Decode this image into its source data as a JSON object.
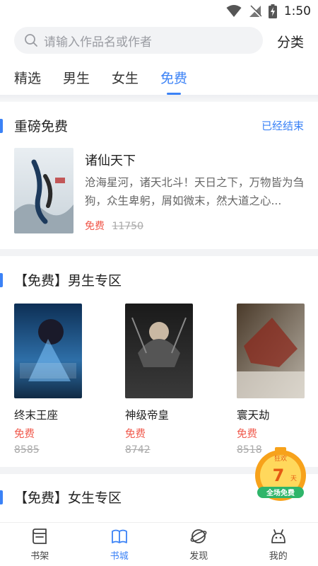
{
  "status_bar": {
    "time": "1:50"
  },
  "search": {
    "placeholder": "请输入作品名或作者",
    "category_label": "分类"
  },
  "tabs": [
    {
      "label": "精选",
      "active": false
    },
    {
      "label": "男生",
      "active": false
    },
    {
      "label": "女生",
      "active": false
    },
    {
      "label": "免费",
      "active": true
    }
  ],
  "featured_section": {
    "title": "重磅免费",
    "status_link": "已经结束",
    "book": {
      "title": "诸仙天下",
      "description": "沧海星河，诸天北斗！天日之下，万物皆为刍狗，众生卑躬，屑如微末，然大道之心...",
      "price_label": "免费",
      "original_price": "11750"
    }
  },
  "male_section": {
    "title": "【免费】男生专区",
    "books": [
      {
        "title": "终末王座",
        "price_label": "免费",
        "original_price": "8585"
      },
      {
        "title": "神级帝皇",
        "price_label": "免费",
        "original_price": "8742"
      },
      {
        "title": "寰天劫",
        "price_label": "免费",
        "original_price": "8518"
      }
    ]
  },
  "female_section": {
    "title": "【免费】女生专区"
  },
  "promo_badge": {
    "top": "狂欢",
    "number": "7",
    "unit": "天",
    "bottom": "全场免费"
  },
  "bottom_nav": [
    {
      "label": "书架",
      "icon": "bookshelf-icon",
      "active": false
    },
    {
      "label": "书城",
      "icon": "bookstore-icon",
      "active": true
    },
    {
      "label": "发现",
      "icon": "planet-icon",
      "active": false
    },
    {
      "label": "我的",
      "icon": "profile-icon",
      "active": false
    }
  ],
  "colors": {
    "accent": "#3b82f6",
    "price_red": "#f0574a",
    "promo_orange": "#f7a21b"
  }
}
